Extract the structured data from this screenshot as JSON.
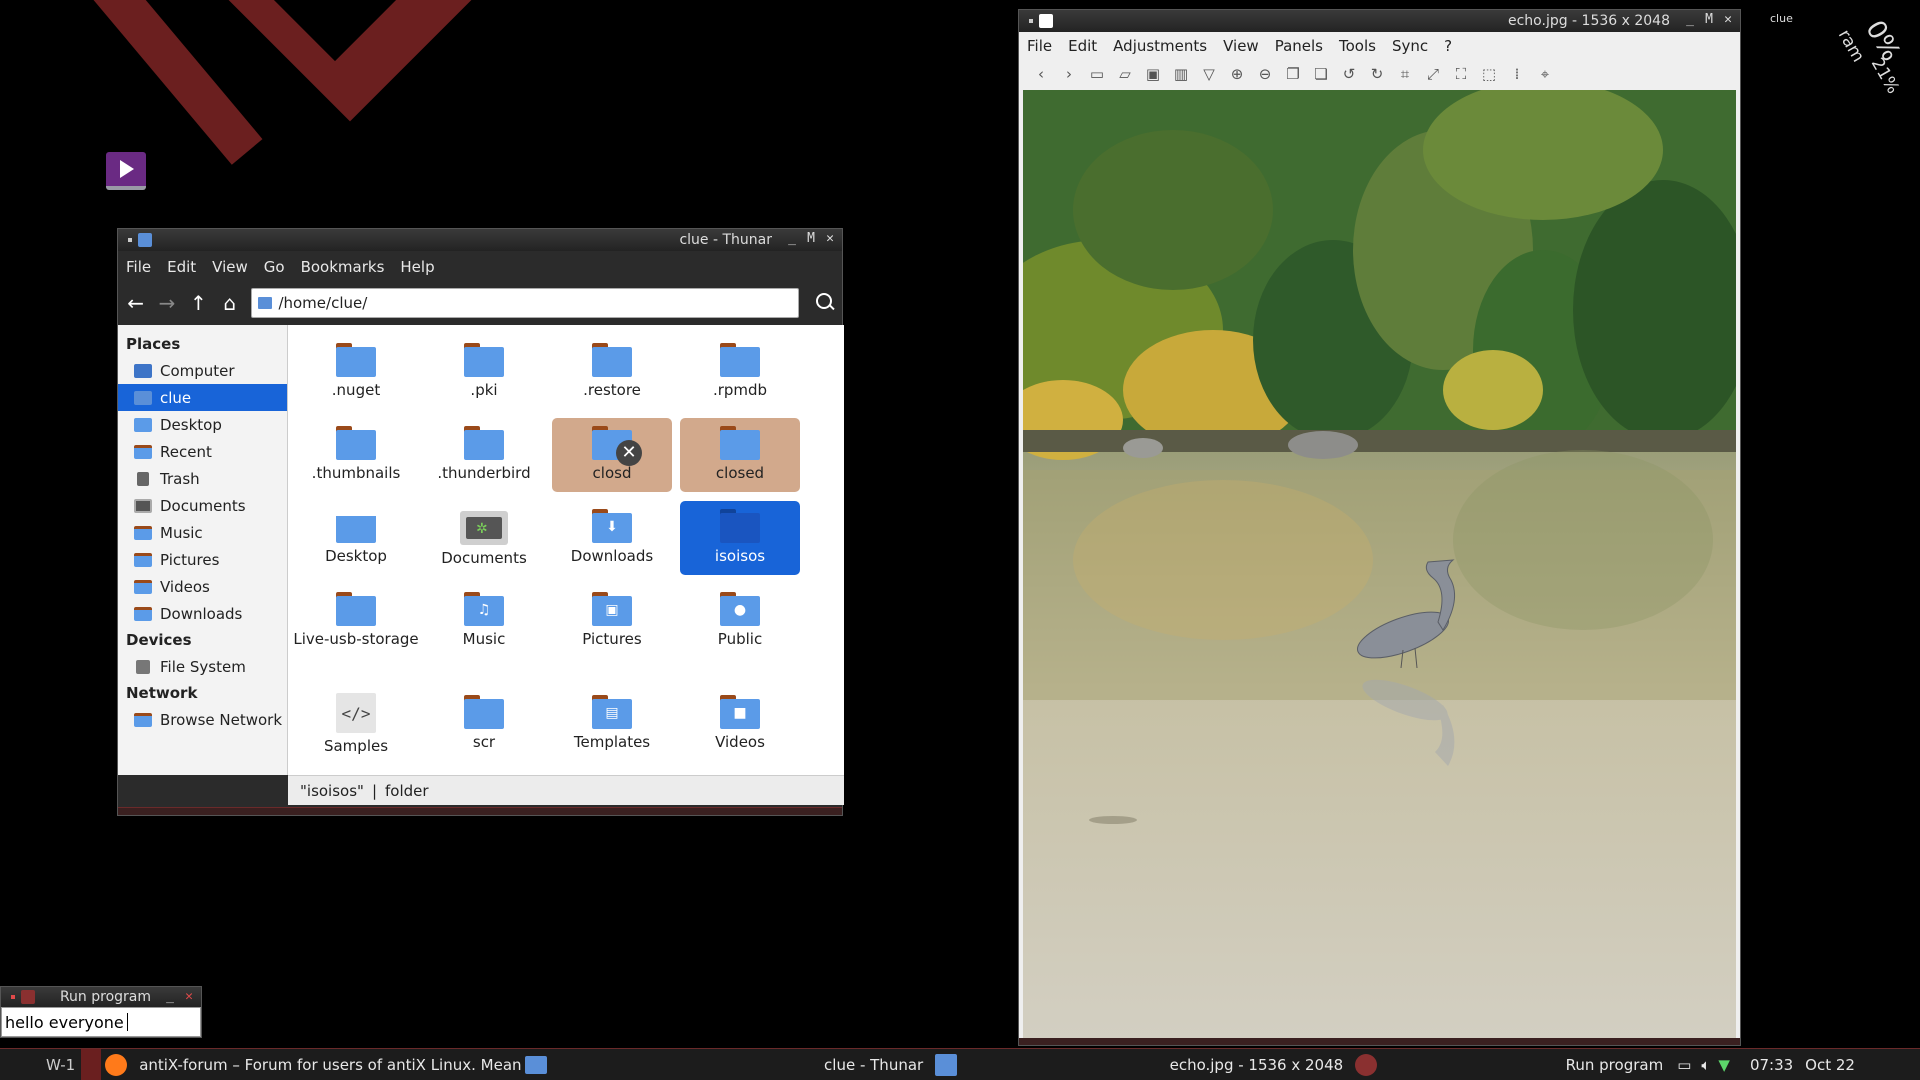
{
  "desktop": {
    "conky_user": "clue",
    "conky_percent": "0%",
    "conky_ram_label": "ram",
    "conky_ram_value": "21%"
  },
  "thunar": {
    "title": "clue - Thunar",
    "menu": [
      "File",
      "Edit",
      "View",
      "Go",
      "Bookmarks",
      "Help"
    ],
    "path": "/home/clue/",
    "sidebar": {
      "places_header": "Places",
      "places": [
        "Computer",
        "clue",
        "Desktop",
        "Recent",
        "Trash",
        "Documents",
        "Music",
        "Pictures",
        "Videos",
        "Downloads"
      ],
      "devices_header": "Devices",
      "devices": [
        "File System"
      ],
      "network_header": "Network",
      "network": [
        "Browse Network"
      ]
    },
    "items": [
      {
        "label": ".nuget"
      },
      {
        "label": ".pki"
      },
      {
        "label": ".restore"
      },
      {
        "label": ".rpmdb"
      },
      {
        "label": ".thumbnails"
      },
      {
        "label": ".thunderbird"
      },
      {
        "label": "closd"
      },
      {
        "label": "closed"
      },
      {
        "label": "Desktop"
      },
      {
        "label": "Documents"
      },
      {
        "label": "Downloads"
      },
      {
        "label": "isoisos"
      },
      {
        "label": "Live-usb-storage"
      },
      {
        "label": "Music"
      },
      {
        "label": "Pictures"
      },
      {
        "label": "Public"
      },
      {
        "label": "Samples"
      },
      {
        "label": "scr"
      },
      {
        "label": "Templates"
      },
      {
        "label": "Videos"
      }
    ],
    "status_name": "\"isoisos\"",
    "status_sep": "|",
    "status_type": "folder"
  },
  "viewer": {
    "title": "echo.jpg  - 1536 x 2048",
    "menu": [
      "File",
      "Edit",
      "Adjustments",
      "View",
      "Panels",
      "Tools",
      "Sync",
      "?"
    ]
  },
  "run": {
    "title": "Run program",
    "value": "hello everyone"
  },
  "taskbar": {
    "workspace": "W-1",
    "firefox_task": "antiX-forum – Forum for users of antiX Linux. Mean",
    "thunar_task": "clue - Thunar",
    "viewer_task": "echo.jpg  - 1536 x 2048",
    "run_task": "Run program",
    "time": "07:33",
    "date": "Oct 22"
  }
}
